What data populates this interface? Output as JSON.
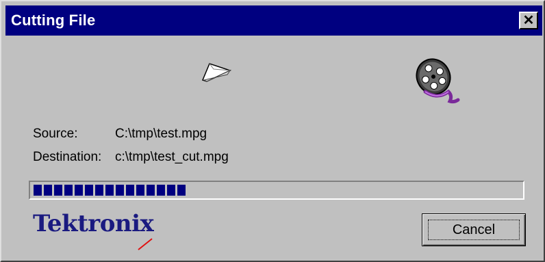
{
  "window": {
    "title": "Cutting File",
    "close_glyph": "✕"
  },
  "icons": {
    "source_paper": "paper-file-icon",
    "film_reel": "film-reel-icon"
  },
  "fields": {
    "source_label": "Source:",
    "source_value": "C:\\tmp\\test.mpg",
    "destination_label": "Destination:",
    "destination_value": "c:\\tmp\\test_cut.mpg"
  },
  "progress": {
    "fraction": 0.31,
    "filled_blocks": 15
  },
  "branding": {
    "logo_text": "Tektronix",
    "logo_color": "#1a1a80",
    "accent_color": "#e01010"
  },
  "buttons": {
    "cancel_label": "Cancel"
  },
  "colors": {
    "title_bar": "#000080",
    "progress_fill": "#000080",
    "face": "#c0c0c0"
  }
}
